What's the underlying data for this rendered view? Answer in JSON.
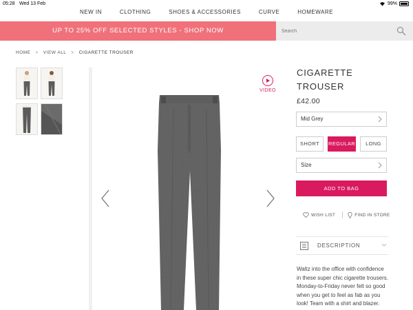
{
  "status_bar": {
    "time": "05:28",
    "date": "Wed 13 Feb",
    "battery": "99%"
  },
  "nav": {
    "items": [
      "NEW IN",
      "CLOTHING",
      "SHOES & ACCESSORIES",
      "CURVE",
      "HOMEWARE"
    ]
  },
  "promo": {
    "text": "UP TO 25% OFF SELECTED STYLES - SHOP NOW",
    "color": "#f0717a"
  },
  "search": {
    "placeholder": "Search"
  },
  "breadcrumb": {
    "items": [
      "HOME",
      "VIEW ALL",
      "CIGARETTE TROUSER"
    ]
  },
  "gallery": {
    "thumbnails": [
      "model-front",
      "model-back",
      "model-legs",
      "fabric-detail"
    ],
    "video_label": "VIDEO"
  },
  "product": {
    "title": "CIGARETTE TROUSER",
    "price": "£42.00",
    "colour": "Mid Grey",
    "lengths": [
      "SHORT",
      "REGULAR",
      "LONG"
    ],
    "selected_length": "REGULAR",
    "size_label": "Size",
    "add_to_bag": "ADD TO BAG",
    "wish_list": "WISH LIST",
    "find_in_store": "FIND IN STORE",
    "description_label": "DESCRIPTION",
    "description_text": "Waltz into the office with confidence in these super chic cigarette trousers. Monday-to-Friday never felt so good when you get to feel as fab as you look! Team with a shirt and blazer.",
    "accent_color": "#d91a5f"
  }
}
